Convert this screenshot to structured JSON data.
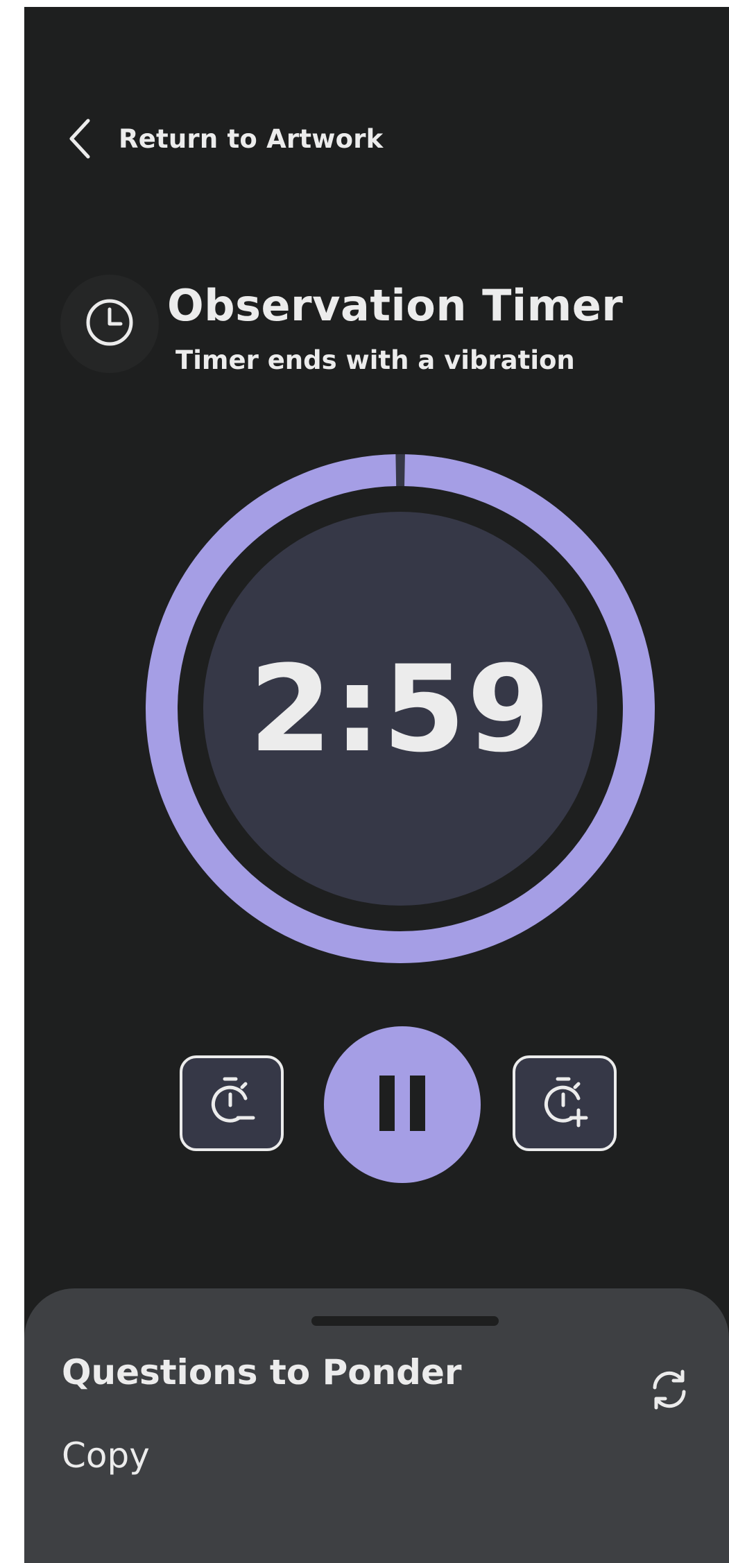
{
  "nav": {
    "back_label": "Return to Artwork",
    "back_icon": "chevron-left-icon"
  },
  "header": {
    "icon": "clock-icon",
    "title": "Observation Timer",
    "subtitle": "Timer ends with a vibration"
  },
  "timer": {
    "display": "2:59",
    "progress_remaining": 0.994
  },
  "controls": {
    "decrease_icon": "stopwatch-minus-icon",
    "pause_icon": "pause-icon",
    "increase_icon": "stopwatch-plus-icon"
  },
  "sheet": {
    "title": "Questions to Ponder",
    "body": "Copy",
    "refresh_icon": "refresh-icon"
  },
  "colors": {
    "background": "#1e1f1f",
    "accent": "#a59ee5",
    "ring_track": "#363847",
    "inner_circle": "#363847",
    "sheet": "#3e4043",
    "text": "#ececec"
  }
}
